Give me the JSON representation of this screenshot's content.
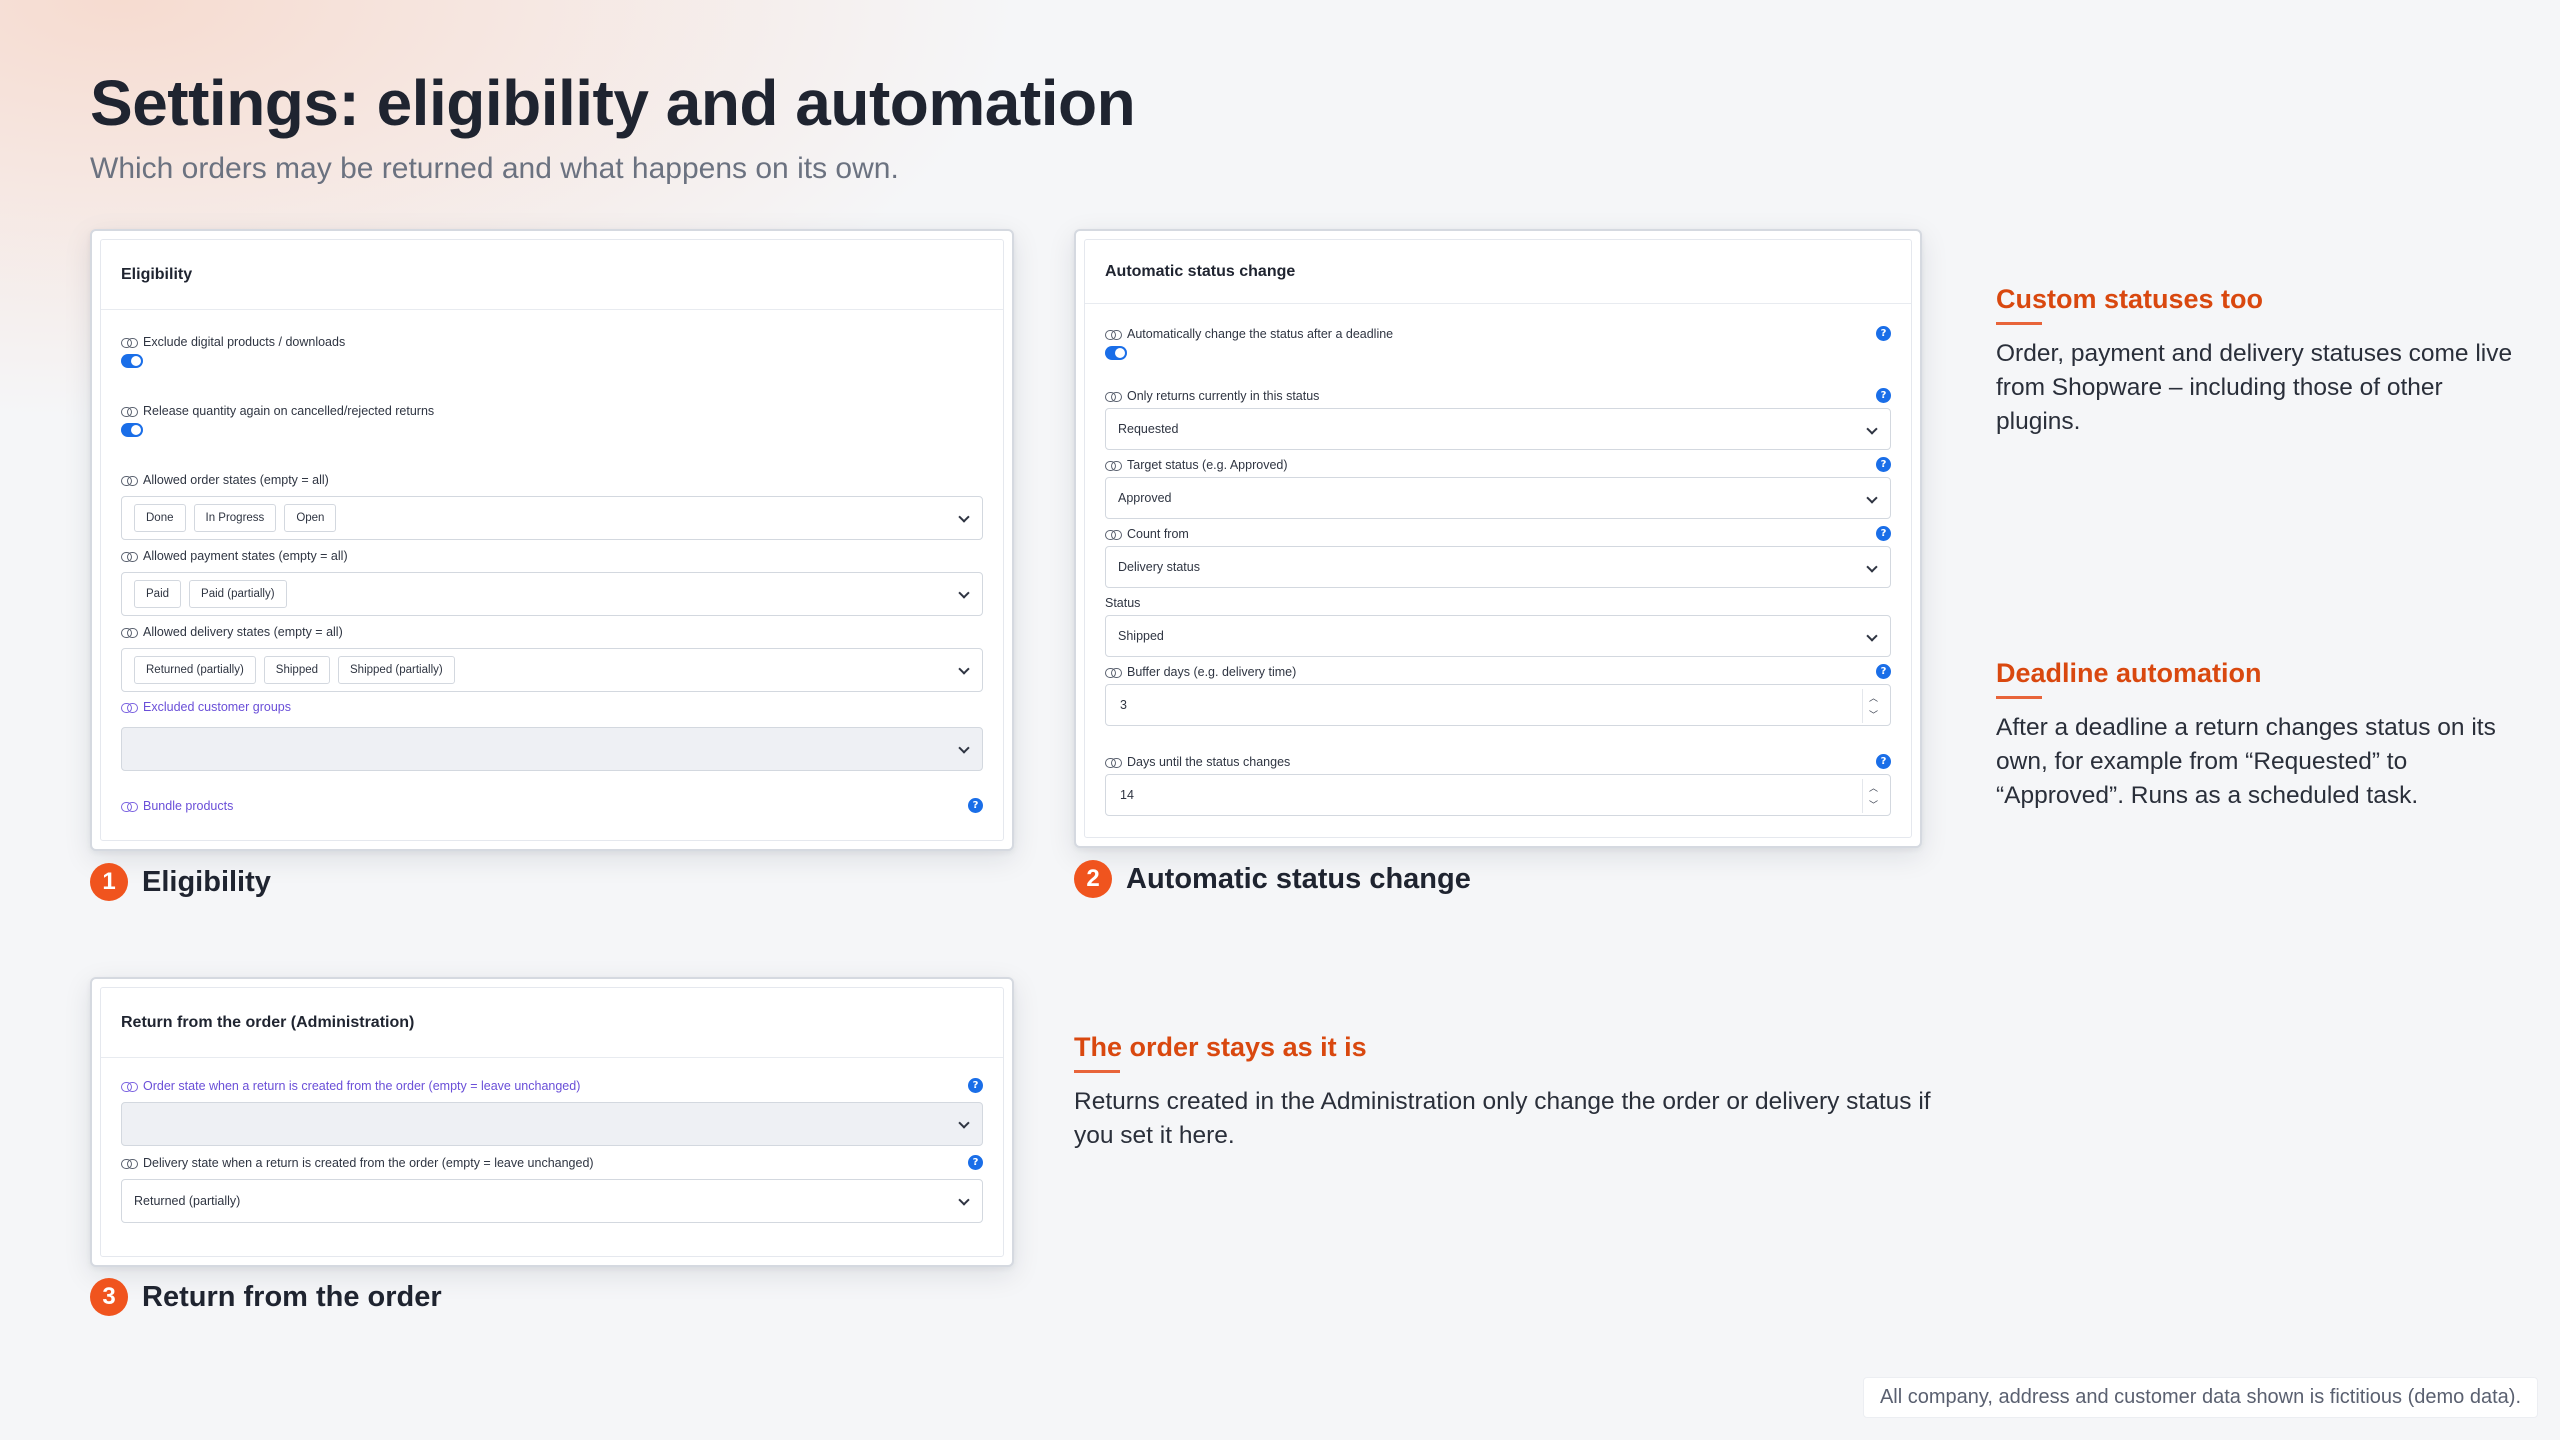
{
  "page": {
    "title": "Settings: eligibility and automation",
    "subtitle": "Which orders may be returned and what happens on its own.",
    "footer_note": "All company, address and customer data shown is fictitious (demo data)."
  },
  "accent_color": "#f0541e",
  "link_color": "#1a6ee8",
  "panel1": {
    "header": "Eligibility",
    "caption_number": "1",
    "caption": "Eligibility",
    "exclude_digital_label": "Exclude digital products / downloads",
    "exclude_digital_on": true,
    "release_quantity_label": "Release quantity again on cancelled/rejected returns",
    "release_quantity_on": true,
    "order_states_label": "Allowed order states (empty = all)",
    "order_states": [
      "Done",
      "In Progress",
      "Open"
    ],
    "payment_states_label": "Allowed payment states (empty = all)",
    "payment_states": [
      "Paid",
      "Paid (partially)"
    ],
    "delivery_states_label": "Allowed delivery states (empty = all)",
    "delivery_states": [
      "Returned (partially)",
      "Shipped",
      "Shipped (partially)"
    ],
    "excluded_groups_label": "Excluded customer groups",
    "bundle_products_label": "Bundle products",
    "help_icon": "?"
  },
  "panel2": {
    "header": "Automatic status change",
    "caption_number": "2",
    "caption": "Automatic status change",
    "auto_change_label": "Automatically change the status after a deadline",
    "auto_change_on": true,
    "only_returns_label": "Only returns currently in this status",
    "only_returns_value": "Requested",
    "target_status_label": "Target status (e.g. Approved)",
    "target_status_value": "Approved",
    "count_from_label": "Count from",
    "count_from_value": "Delivery status",
    "status_label": "Status",
    "status_value": "Shipped",
    "buffer_days_label": "Buffer days (e.g. delivery time)",
    "buffer_days_value": "3",
    "days_until_label": "Days until the status changes",
    "days_until_value": "14",
    "help_icon": "?"
  },
  "panel3": {
    "header": "Return from the order (Administration)",
    "caption_number": "3",
    "caption": "Return from the order",
    "order_state_label": "Order state when a return is created from the order (empty = leave unchanged)",
    "order_state_value": "",
    "delivery_state_label": "Delivery state when a return is created from the order (empty = leave unchanged)",
    "delivery_state_value": "Returned (partially)",
    "help_icon": "?"
  },
  "info": {
    "custom_statuses": {
      "title": "Custom statuses too",
      "text": "Order, payment and delivery statuses come live from Shopware – including those of other plugins."
    },
    "deadline_automation": {
      "title": "Deadline automation",
      "text": "After a deadline a return changes status on its own, for example from “Requested” to “Approved”. Runs as a scheduled task."
    },
    "order_stays": {
      "title": "The order stays as it is",
      "text": "Returns created in the Administration only change the order or delivery status if you set it here."
    }
  }
}
